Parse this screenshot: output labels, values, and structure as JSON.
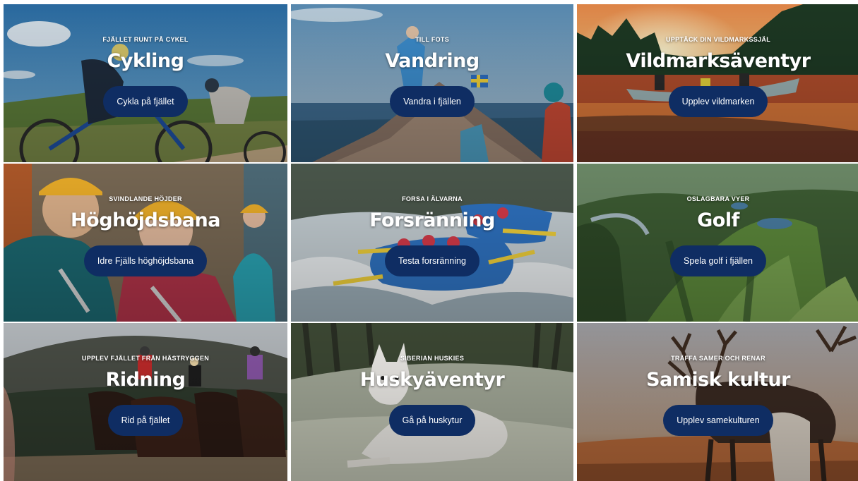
{
  "tiles": [
    {
      "eyebrow": "FJÄLLET RUNT PÅ CYKEL",
      "title": "Cykling",
      "button": "Cykla på fjället"
    },
    {
      "eyebrow": "TILL FOTS",
      "title": "Vandring",
      "button": "Vandra i fjällen"
    },
    {
      "eyebrow": "UPPTÄCK DIN VILDMARKSSJÄL",
      "title": "Vildmarksäventyr",
      "button": "Upplev vildmarken"
    },
    {
      "eyebrow": "SVINDLANDE HÖJDER",
      "title": "Höghöjdsbana",
      "button": "Idre Fjälls höghöjdsbana"
    },
    {
      "eyebrow": "FORSA I ÄLVARNA",
      "title": "Forsränning",
      "button": "Testa forsränning"
    },
    {
      "eyebrow": "OSLAGBARA VYER",
      "title": "Golf",
      "button": "Spela golf i fjällen"
    },
    {
      "eyebrow": "UPPLEV FJÄLLET FRÅN HÄSTRYGGEN",
      "title": "Ridning",
      "button": "Rid på fjället"
    },
    {
      "eyebrow": "SIBERIAN HUSKIES",
      "title": "Huskyäventyr",
      "button": "Gå på huskytur"
    },
    {
      "eyebrow": "TRÄFFA SAMER OCH RENAR",
      "title": "Samisk kultur",
      "button": "Upplev samekulturen"
    }
  ],
  "colors": {
    "button_bg": "#0f2d63",
    "text": "#ffffff"
  }
}
